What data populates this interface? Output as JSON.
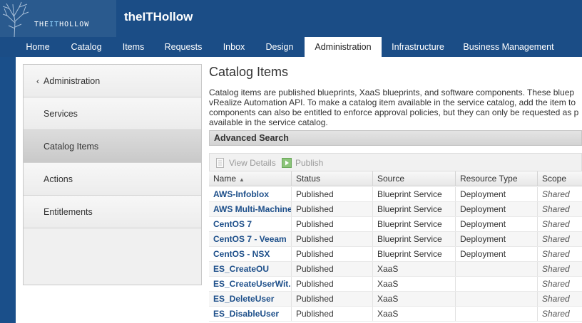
{
  "brand": {
    "logo_prefix": "THE",
    "logo_accent": "IT",
    "logo_suffix": "HOLLOW",
    "app_title": "theITHollow"
  },
  "nav": {
    "tabs": [
      {
        "label": "Home"
      },
      {
        "label": "Catalog"
      },
      {
        "label": "Items"
      },
      {
        "label": "Requests"
      },
      {
        "label": "Inbox"
      },
      {
        "label": "Design"
      },
      {
        "label": "Administration"
      },
      {
        "label": "Infrastructure"
      },
      {
        "label": "Business Management"
      }
    ],
    "active": "Administration"
  },
  "sidebar": {
    "back_label": "Administration",
    "items": [
      {
        "label": "Services"
      },
      {
        "label": "Catalog Items"
      },
      {
        "label": "Actions"
      },
      {
        "label": "Entitlements"
      }
    ],
    "active": "Catalog Items"
  },
  "main": {
    "title": "Catalog Items",
    "description_lines": [
      "Catalog items are published blueprints, XaaS blueprints, and software components. These bluep",
      "vRealize Automation API. To make a catalog item available in the service catalog, add the item to",
      "components can also be entitled to enforce approval policies, but they can only be requested as p",
      "available in the service catalog."
    ],
    "advanced_search": "Advanced Search",
    "toolbar": {
      "view_details": "View Details",
      "publish": "Publish"
    },
    "table": {
      "columns": [
        "Name",
        "Status",
        "Source",
        "Resource Type",
        "Scope"
      ],
      "sort_column": "Name",
      "rows": [
        [
          "AWS-Infoblox",
          "Published",
          "Blueprint Service",
          "Deployment",
          "Shared"
        ],
        [
          "AWS Multi-Machine",
          "Published",
          "Blueprint Service",
          "Deployment",
          "Shared"
        ],
        [
          "CentOS 7",
          "Published",
          "Blueprint Service",
          "Deployment",
          "Shared"
        ],
        [
          "CentOS 7 - Veeam",
          "Published",
          "Blueprint Service",
          "Deployment",
          "Shared"
        ],
        [
          "CentOS - NSX",
          "Published",
          "Blueprint Service",
          "Deployment",
          "Shared"
        ],
        [
          "ES_CreateOU",
          "Published",
          "XaaS",
          "",
          "Shared"
        ],
        [
          "ES_CreateUserWit...",
          "Published",
          "XaaS",
          "",
          "Shared"
        ],
        [
          "ES_DeleteUser",
          "Published",
          "XaaS",
          "",
          "Shared"
        ],
        [
          "ES_DisableUser",
          "Published",
          "XaaS",
          "",
          "Shared"
        ]
      ]
    }
  }
}
